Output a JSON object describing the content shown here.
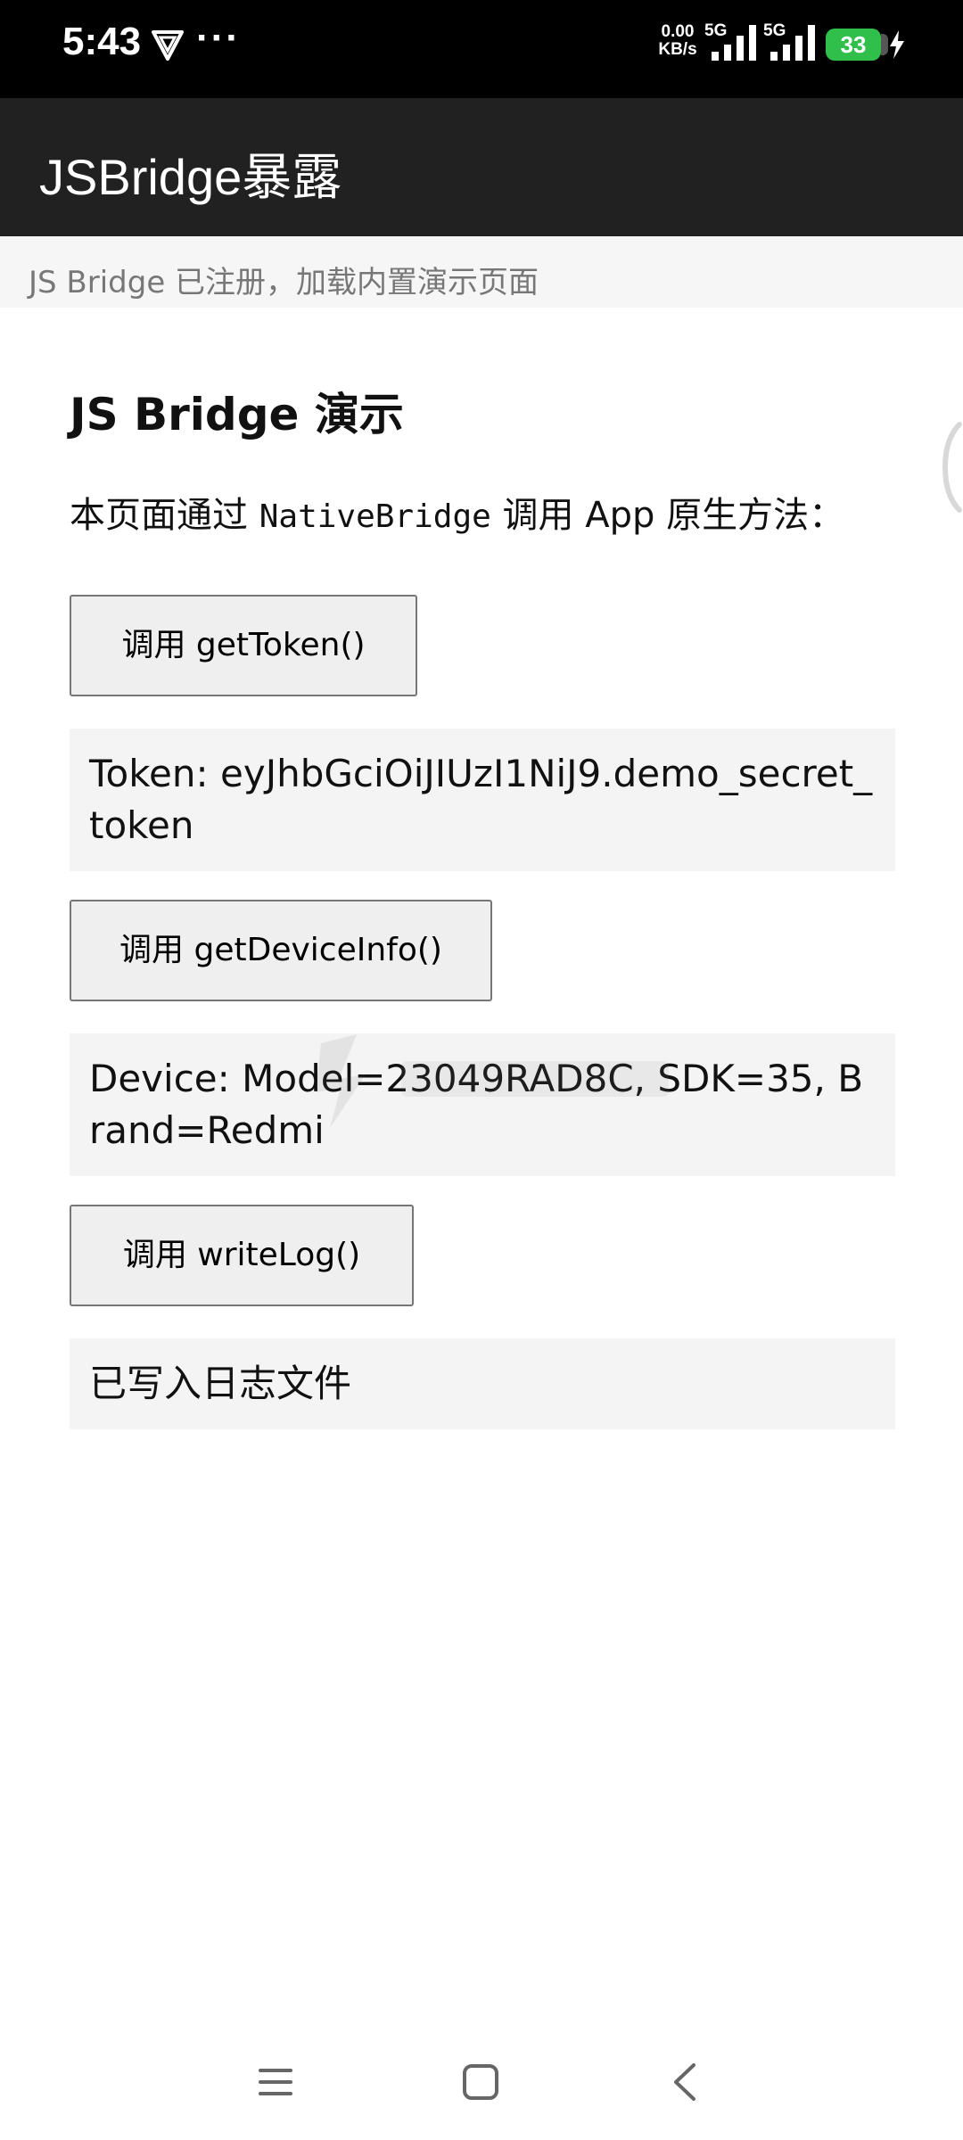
{
  "status_bar": {
    "time": "5:43",
    "dots": "···",
    "net_speed_value": "0.00",
    "net_speed_unit": "KB/s",
    "sim1_label": "5G",
    "sim2_label": "5G",
    "battery": "33"
  },
  "app_bar": {
    "title": "JSBridge暴露"
  },
  "status_strip": {
    "text": "JS Bridge 已注册，加载内置演示页面"
  },
  "page": {
    "heading": "JS Bridge 演示",
    "intro_before": "本页面通过 ",
    "intro_code": "NativeBridge",
    "intro_after": " 调用 App 原生方法："
  },
  "buttons": [
    {
      "label": "调用 getToken()",
      "result": "Token: eyJhbGciOiJIUzI1NiJ9.demo_secret_token"
    },
    {
      "label": "调用 getDeviceInfo()",
      "result": "Device: Model=23049RAD8C, SDK=35, Brand=Redmi"
    },
    {
      "label": "调用 writeLog()",
      "result": "已写入日志文件"
    }
  ],
  "colors": {
    "app_bar": "#212121",
    "battery": "#2fbf4a"
  },
  "icons": {
    "vpn": "vpn-icon",
    "menu": "menu-icon",
    "home": "home-icon",
    "back": "back-icon"
  }
}
